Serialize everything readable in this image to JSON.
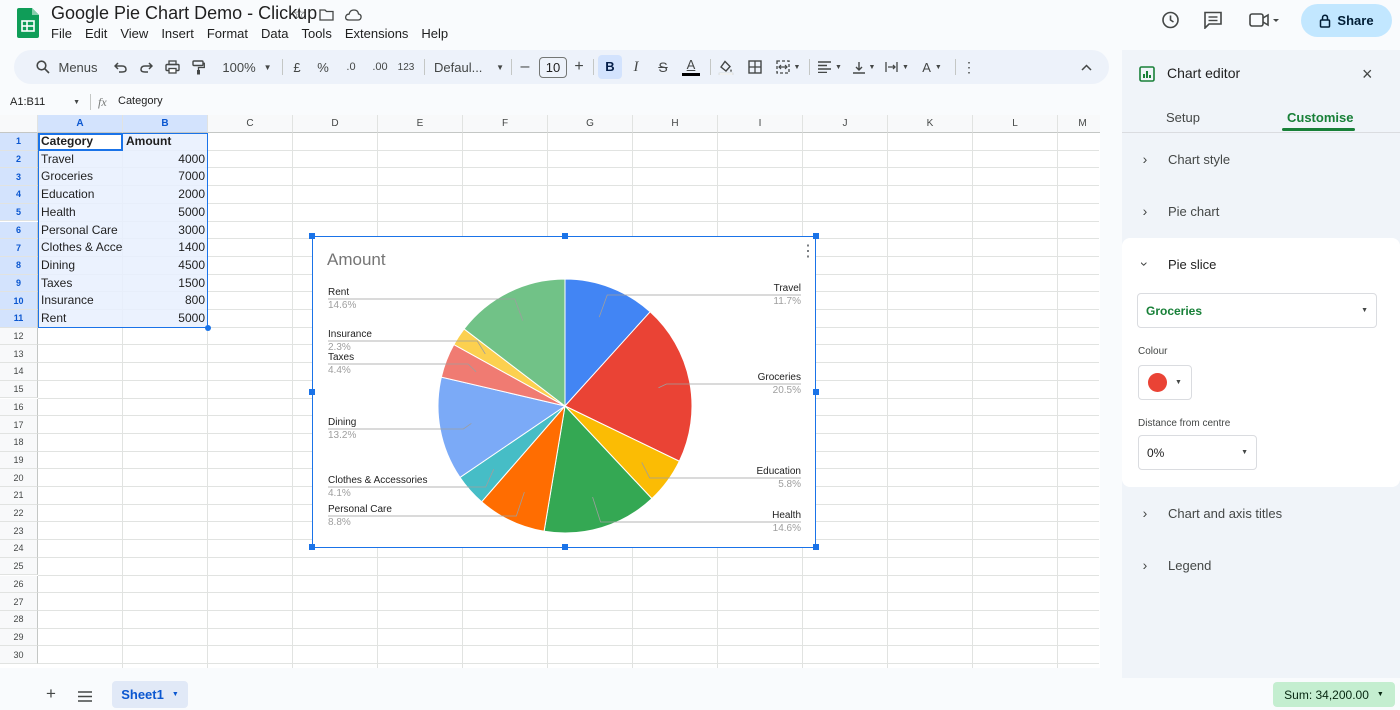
{
  "app": {
    "title": "Google Pie Chart Demo - Clickup",
    "menus": [
      "File",
      "Edit",
      "View",
      "Insert",
      "Format",
      "Data",
      "Tools",
      "Extensions",
      "Help"
    ],
    "share_label": "Share"
  },
  "toolbar": {
    "menus_label": "Menus",
    "zoom": "100%",
    "currency": "£",
    "percent": "%",
    "dec_decrease": ".0",
    "dec_increase": ".00",
    "number_format": "123",
    "font": "Defaul...",
    "font_size": "10",
    "bold": "B",
    "italic": "I",
    "strike": "S",
    "text_color": "A"
  },
  "formula_bar": {
    "cell_ref": "A1:B11",
    "fx": "fx",
    "content": "Category"
  },
  "sheet": {
    "columns": [
      "A",
      "B",
      "C",
      "D",
      "E",
      "F",
      "G",
      "H",
      "I",
      "J",
      "K",
      "L",
      "M"
    ],
    "row_numbers": [
      "1",
      "2",
      "3",
      "4",
      "5",
      "6",
      "7",
      "8",
      "9",
      "10",
      "11",
      "12",
      "13",
      "14",
      "15",
      "16",
      "17",
      "18",
      "19",
      "20",
      "21",
      "22",
      "23",
      "24",
      "25",
      "26",
      "27",
      "28",
      "29",
      "30"
    ],
    "rows": [
      {
        "a": "Category",
        "b": "Amount"
      },
      {
        "a": "Travel",
        "b": "4000"
      },
      {
        "a": "Groceries",
        "b": "7000"
      },
      {
        "a": "Education",
        "b": "2000"
      },
      {
        "a": "Health",
        "b": "5000"
      },
      {
        "a": "Personal Care",
        "b": "3000"
      },
      {
        "a": "Clothes & Acces",
        "b": "1400"
      },
      {
        "a": "Dining",
        "b": "4500"
      },
      {
        "a": "Taxes",
        "b": "1500"
      },
      {
        "a": "Insurance",
        "b": "800"
      },
      {
        "a": "Rent",
        "b": "5000"
      }
    ]
  },
  "chart_data": {
    "type": "pie",
    "title": "Amount",
    "categories": [
      "Travel",
      "Groceries",
      "Education",
      "Health",
      "Personal Care",
      "Clothes & Accessories",
      "Dining",
      "Taxes",
      "Insurance",
      "Rent"
    ],
    "values": [
      4000,
      7000,
      2000,
      5000,
      3000,
      1400,
      4500,
      1500,
      800,
      5000
    ],
    "percent_labels": [
      "11.7%",
      "20.5%",
      "5.8%",
      "14.6%",
      "8.8%",
      "4.1%",
      "13.2%",
      "4.4%",
      "2.3%",
      "14.6%"
    ],
    "colors": [
      "#4285f4",
      "#ea4335",
      "#fbbc04",
      "#34a853",
      "#ff6d01",
      "#46bdc6",
      "#7baaf7",
      "#f07b72",
      "#fcd04f",
      "#71c287"
    ]
  },
  "chart_editor": {
    "title": "Chart editor",
    "tabs": [
      "Setup",
      "Customise"
    ],
    "sections": [
      "Chart style",
      "Pie chart",
      "Pie slice",
      "Chart and axis titles",
      "Legend"
    ],
    "slice_select": "Groceries",
    "colour_label": "Colour",
    "colour_value": "#ea4335",
    "distance_label": "Distance from centre",
    "distance_value": "0%"
  },
  "bottom": {
    "sheet_tab": "Sheet1",
    "sum": "Sum: 34,200.00"
  }
}
